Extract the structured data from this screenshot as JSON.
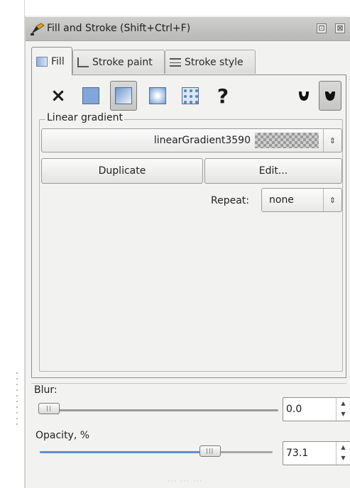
{
  "window": {
    "title": "Fill and Stroke (Shift+Ctrl+F)",
    "pin_glyph": "⊡",
    "close_glyph": "⊠"
  },
  "tabs": [
    {
      "label": "Fill",
      "icon": "fill-tab-icon"
    },
    {
      "label": "Stroke paint",
      "icon": "stroke-paint-tab-icon"
    },
    {
      "label": "Stroke style",
      "icon": "stroke-style-tab-icon"
    }
  ],
  "paint_types": {
    "none_glyph": "×",
    "unset_glyph": "?",
    "selected": "linear-gradient"
  },
  "gradient": {
    "section_label": "Linear gradient",
    "selected_gradient": "linearGradient3590",
    "duplicate_label": "Duplicate",
    "edit_label": "Edit...",
    "repeat_label": "Repeat:",
    "repeat_value": "none"
  },
  "blur": {
    "label": "Blur:",
    "value": "0.0",
    "level": 0.0
  },
  "opacity": {
    "label": "Opacity, %",
    "value": "73.1",
    "level": 73.1
  },
  "colors": {
    "accent": "#5f8fd0",
    "titlebar": "#c4c4c2"
  }
}
